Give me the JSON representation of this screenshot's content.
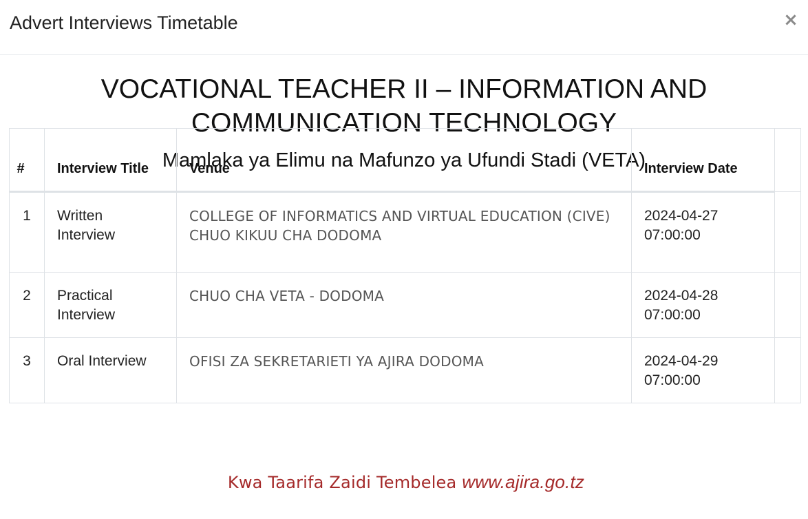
{
  "modal": {
    "title": "Advert Interviews Timetable",
    "close_icon": "×"
  },
  "job": {
    "title": "VOCATIONAL TEACHER II – INFORMATION AND COMMUNICATION TECHNOLOGY",
    "employer": "Mamlaka ya Elimu na Mafunzo ya Ufundi Stadi (VETA)"
  },
  "table": {
    "headers": {
      "num": "#",
      "title": "Interview Title",
      "venue": "Venue",
      "date": "Interview Date"
    },
    "rows": [
      {
        "num": "1",
        "title": "Written Interview",
        "venue": "COLLEGE OF INFORMATICS AND  VIRTUAL EDUCATION (CIVE) CHUO KIKUU CHA DODOMA",
        "date": "2024-04-27 07:00:00"
      },
      {
        "num": "2",
        "title": "Practical Interview",
        "venue": "CHUO CHA VETA - DODOMA",
        "date": "2024-04-28 07:00:00"
      },
      {
        "num": "3",
        "title": "Oral Interview",
        "venue": "OFISI ZA SEKRETARIETI YA AJIRA DODOMA",
        "date": "2024-04-29 07:00:00"
      }
    ]
  },
  "footer": {
    "text": "Kwa Taarifa Zaidi Tembelea ",
    "link": "www.ajira.go.tz",
    "color": "#a52a2a"
  }
}
